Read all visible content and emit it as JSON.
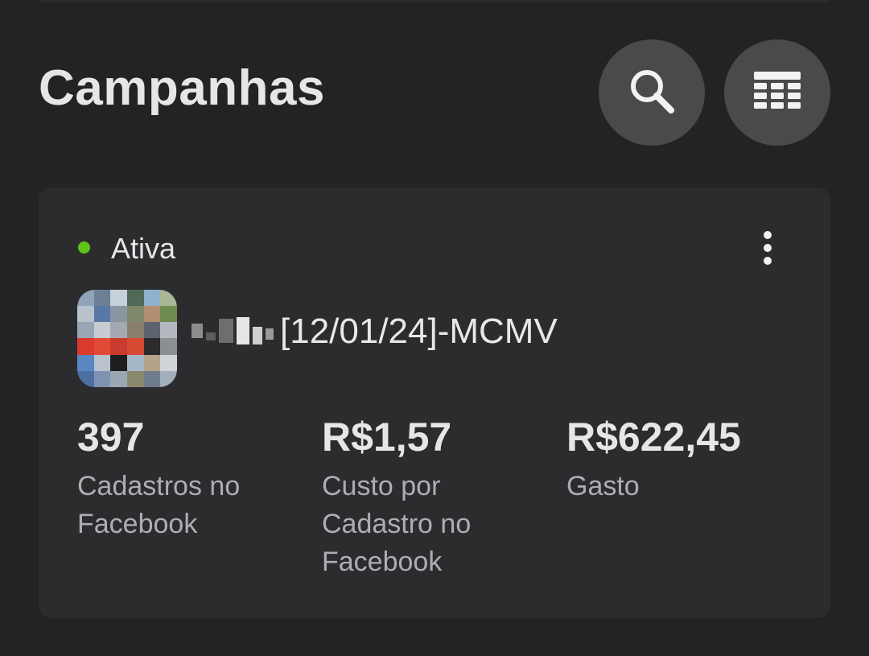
{
  "header": {
    "title": "Campanhas",
    "search_icon": "search-icon",
    "table_icon": "table-icon"
  },
  "campaign": {
    "status": "Ativa",
    "status_color": "#5fc41a",
    "name": "[12/01/24]-MCMV",
    "menu_icon": "more-vertical-icon",
    "metrics": [
      {
        "value": "397",
        "label": "Cadastros no Facebook"
      },
      {
        "value": "R$1,57",
        "label": "Custo por Cadastro no Facebook"
      },
      {
        "value": "R$622,45",
        "label": "Gasto"
      }
    ]
  },
  "colors": {
    "background": "#232325",
    "card": "#2c2c2f",
    "button": "#4a4a4d"
  }
}
